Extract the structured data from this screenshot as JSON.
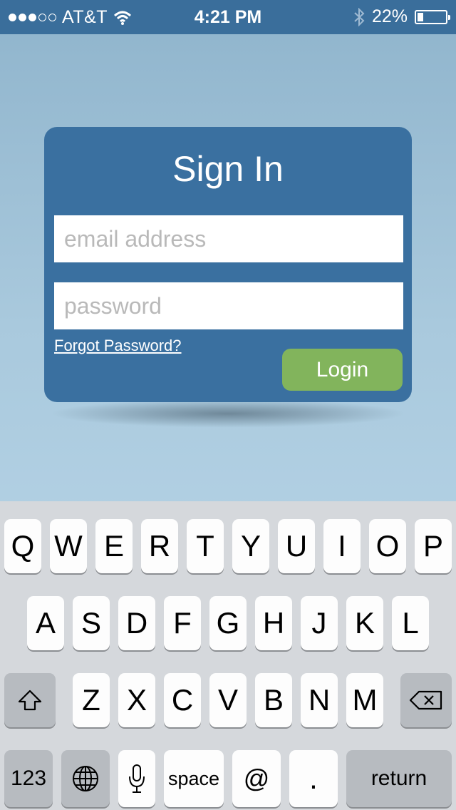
{
  "status_bar": {
    "carrier": "AT&T",
    "time": "4:21 PM",
    "battery_text": "22%",
    "battery_level": 0.22,
    "signal_bars_filled": 3,
    "signal_bars_total": 5,
    "icons": [
      "wifi-icon",
      "bluetooth-icon",
      "battery-icon"
    ]
  },
  "signin": {
    "title": "Sign In",
    "email_placeholder": "email address",
    "email_value": "",
    "password_placeholder": "password",
    "password_value": "",
    "forgot_label": "Forgot Password?",
    "login_label": "Login"
  },
  "keyboard": {
    "row1": [
      "Q",
      "W",
      "E",
      "R",
      "T",
      "Y",
      "U",
      "I",
      "O",
      "P"
    ],
    "row2": [
      "A",
      "S",
      "D",
      "F",
      "G",
      "H",
      "J",
      "K",
      "L"
    ],
    "row3": [
      "Z",
      "X",
      "C",
      "V",
      "B",
      "N",
      "M"
    ],
    "numbers_label": "123",
    "space_label": "space",
    "at_label": "@",
    "period_label": ".",
    "return_label": "return",
    "icons": [
      "shift-icon",
      "backspace-icon",
      "globe-icon",
      "microphone-icon"
    ]
  },
  "colors": {
    "status_bar": "#3a6e9b",
    "card": "#3a70a0",
    "login_button": "#82b45c",
    "keyboard_bg": "#d5d8dc"
  }
}
